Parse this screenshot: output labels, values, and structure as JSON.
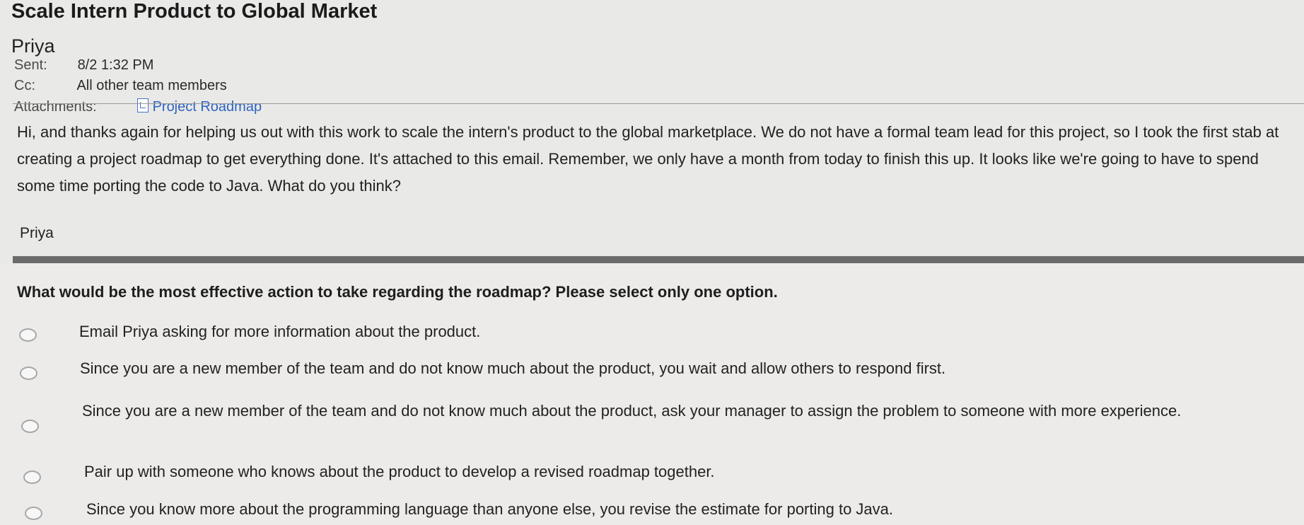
{
  "email": {
    "subject": "Scale Intern Product to Global Market",
    "sender": "Priya",
    "sent_label": "Sent:",
    "sent_value": "8/2 1:32 PM",
    "cc_label": "Cc:",
    "cc_value": "All other team members",
    "attachments_label": "Attachments:",
    "attachment_name": "Project Roadmap",
    "body_paragraph": "Hi, and thanks again for helping us out with this work to scale the intern's product to the global marketplace. We do not have a formal team lead for this project, so I took the first stab at creating a project roadmap to get everything done. It's attached to this email. Remember, we only have a month from today to finish this up. It looks like we're going to have to spend some time porting the code to Java. What do you think?",
    "signature": "Priya"
  },
  "question": {
    "text": "What would be the most effective action to take regarding the roadmap? Please select only one option.",
    "options": [
      "Email Priya asking for more information about the product.",
      "Since you are a new member of the team and do not know much about the product, you wait and allow others to respond first.",
      "Since you are a new member of the team and do not know much about the product, ask your manager to assign the problem to someone with more experience.",
      "Pair up with someone who knows about the product to develop a revised roadmap together.",
      "Since you know more about the programming language than anyone else, you revise the estimate for porting to Java."
    ]
  },
  "icons": {
    "attachment": "file-icon",
    "option_selector": "radio-circle"
  },
  "colors": {
    "link": "#2f63c2",
    "header_bar": "#6b6b6b"
  }
}
